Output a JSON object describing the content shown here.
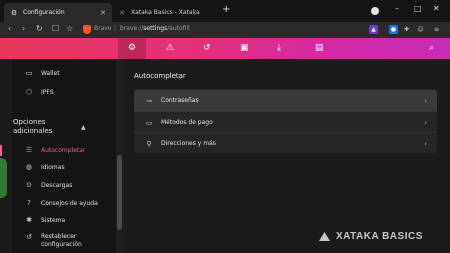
{
  "tabs": [
    {
      "title": "Configuración",
      "active": true,
      "favicon": "gear-icon"
    },
    {
      "title": "Xataka Basics - Xataka",
      "active": false,
      "favicon": "xataka-x-icon"
    }
  ],
  "window_controls": {
    "minimize": "–",
    "maximize": "□",
    "close": "✕"
  },
  "addressbar": {
    "brave_label": "Brave",
    "url_prefix": "brave://",
    "url_path": "settings",
    "url_suffix": "/autofill"
  },
  "header_icons": [
    "gear-icon",
    "warning-icon",
    "history-icon",
    "save-icon",
    "download-icon",
    "folder-icon",
    "search-icon"
  ],
  "sidebar": {
    "top_items": [
      {
        "label": "Wallet",
        "icon": "wallet-icon"
      },
      {
        "label": "IPFS",
        "icon": "ipfs-icon"
      }
    ],
    "section_title": "Opciones adicionales",
    "items": [
      {
        "label": "Autocompletar",
        "icon": "autofill-icon",
        "active": true
      },
      {
        "label": "Idiomas",
        "icon": "globe-icon",
        "active": false
      },
      {
        "label": "Descargas",
        "icon": "download-icon",
        "active": false
      },
      {
        "label": "Consejos de ayuda",
        "icon": "help-icon",
        "active": false
      },
      {
        "label": "Sistema",
        "icon": "wrench-icon",
        "active": false
      },
      {
        "label": "Restablecer configuración",
        "icon": "reset-icon",
        "active": false
      }
    ]
  },
  "main": {
    "title": "Autocompletar",
    "rows": [
      {
        "label": "Contraseñas",
        "icon": "key-icon"
      },
      {
        "label": "Métodos de pago",
        "icon": "credit-card-icon"
      },
      {
        "label": "Direcciones y más",
        "icon": "location-pin-icon"
      }
    ]
  },
  "watermark": "XATAKA BASICS",
  "colors": {
    "accent": "#f0609a",
    "header_start": "#e8365a",
    "header_end": "#c72bb5"
  }
}
